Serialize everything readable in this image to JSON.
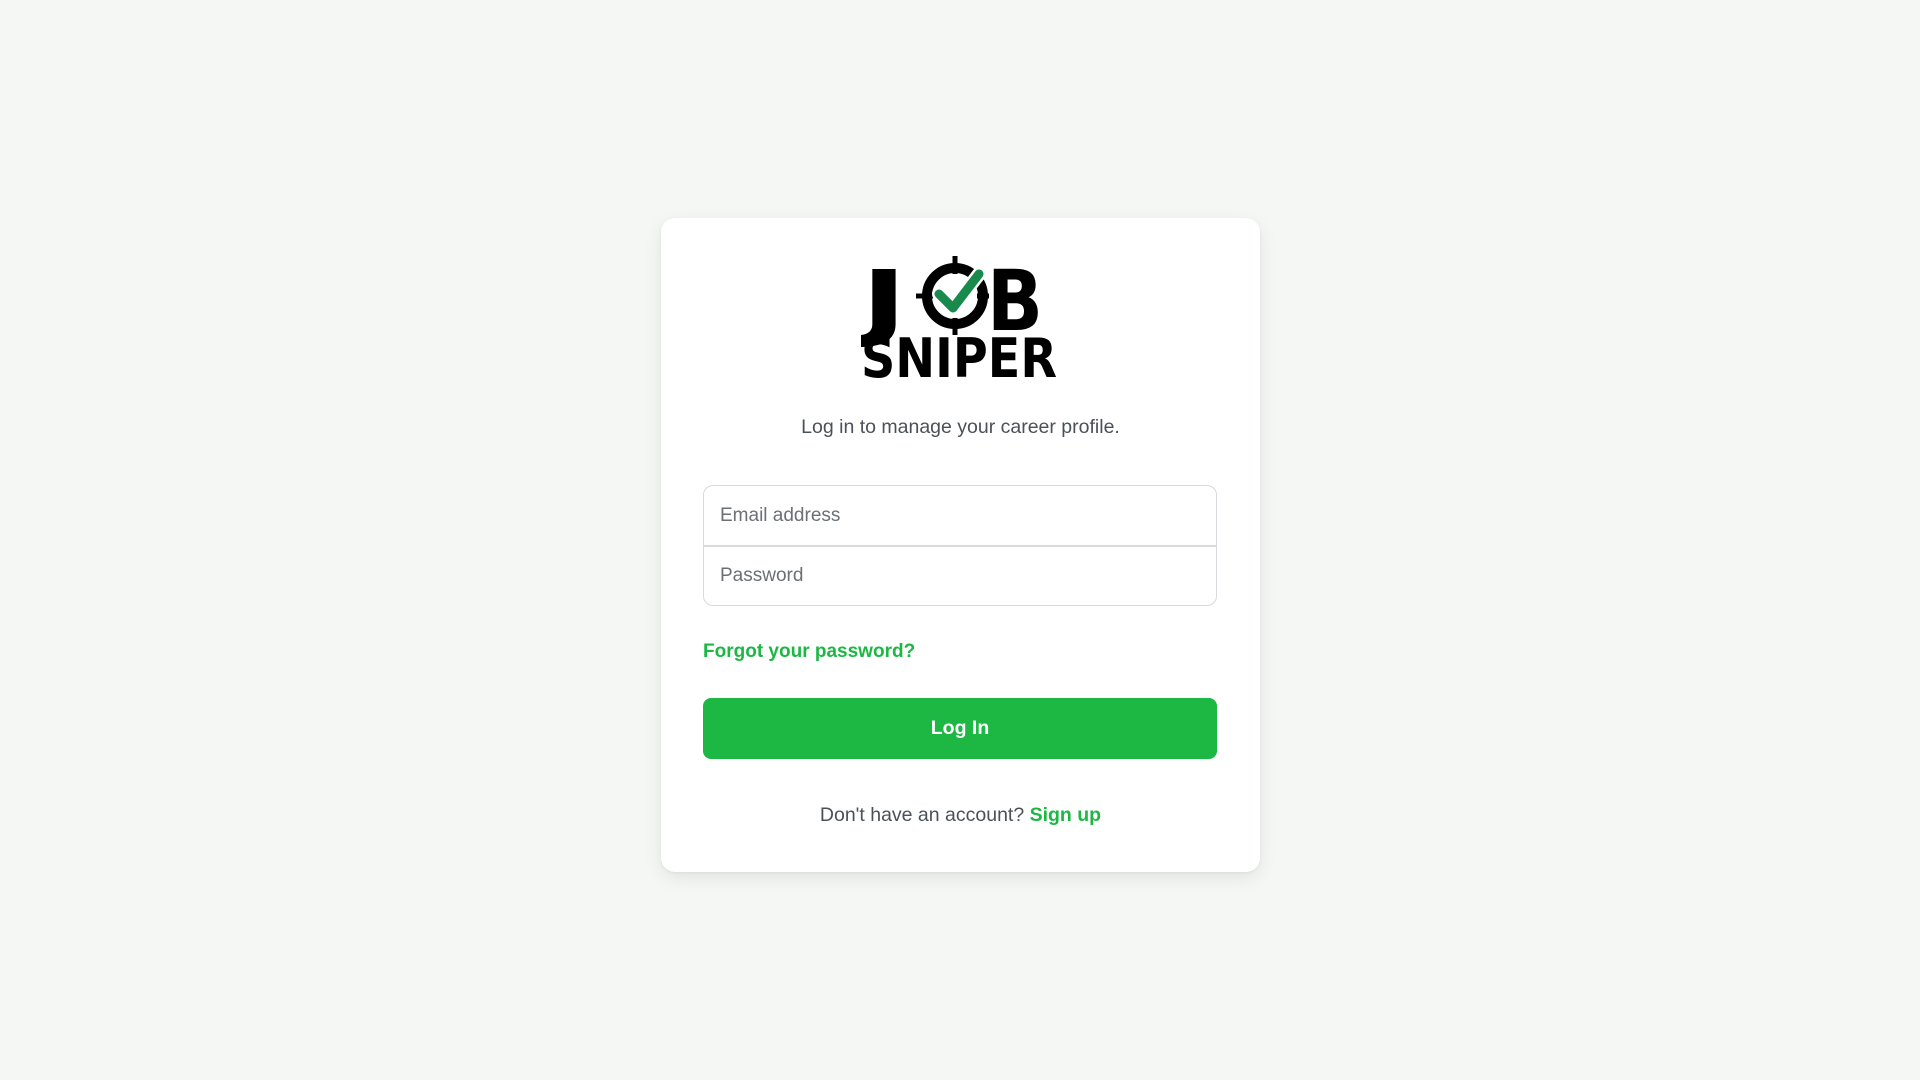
{
  "brand": {
    "logo_line1": "JOB",
    "logo_line2": "SNIPER",
    "accent_color": "#1db844",
    "check_color": "#178a4c"
  },
  "login": {
    "subtitle": "Log in to manage your career profile.",
    "email_placeholder": "Email address",
    "email_value": "",
    "password_placeholder": "Password",
    "password_value": "",
    "forgot_label": "Forgot your password?",
    "submit_label": "Log In",
    "no_account_text": "Don't have an account?",
    "signup_label": "Sign up"
  },
  "icons": {
    "logo": "crosshair-check-icon"
  }
}
